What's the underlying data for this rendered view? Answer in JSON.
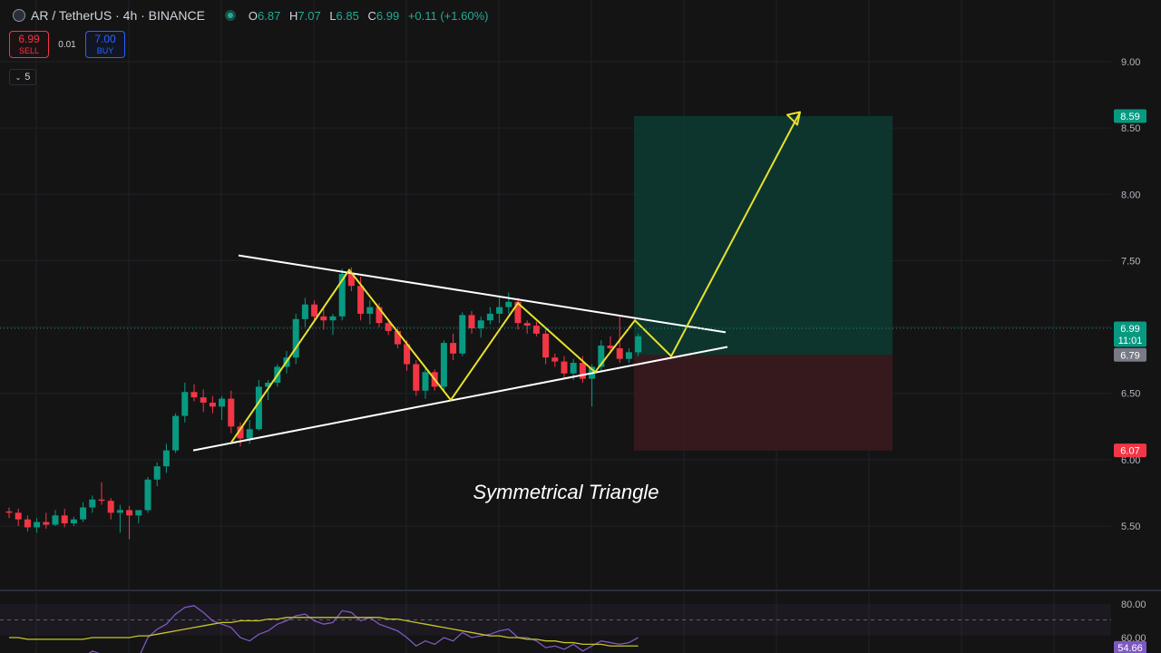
{
  "header": {
    "symbol": "AR / TetherUS · 4h · BINANCE",
    "ohlc": {
      "o_label": "O",
      "o": "6.87",
      "h_label": "H",
      "h": "7.07",
      "l_label": "L",
      "l": "6.85",
      "c_label": "C",
      "c": "6.99",
      "change": "+0.11 (+1.60%)"
    }
  },
  "trade": {
    "sell_price": "6.99",
    "sell_label": "SELL",
    "spread": "0.01",
    "buy_price": "7.00",
    "buy_label": "BUY"
  },
  "indicators_collapse": {
    "count": "5"
  },
  "colors": {
    "up": "#089981",
    "down": "#f23645",
    "pattern_lines": "#ffffff",
    "zigzag": "#e8e12d",
    "rsi": "#7e57c2",
    "rsi_ma": "#c5c52a",
    "target_zone": "#0d3b31",
    "stop_zone": "#3c1a1e"
  },
  "chart_data": {
    "type": "candlestick",
    "title": "Symmetrical Triangle",
    "price_axis": {
      "ticks": [
        "9.00",
        "8.50",
        "8.00",
        "7.50",
        "6.50",
        "6.00",
        "5.50"
      ],
      "range": [
        5.2,
        9.3
      ]
    },
    "labels": {
      "target": {
        "value": "8.59",
        "color": "#089981"
      },
      "last": {
        "value": "6.99",
        "time": "11:01",
        "color": "#089981"
      },
      "entry": {
        "value": "6.79",
        "color": "#787b86"
      },
      "stop": {
        "value": "6.07",
        "color": "#f23645"
      }
    },
    "candles": [
      [
        5.61,
        5.64,
        5.56,
        5.6
      ],
      [
        5.6,
        5.63,
        5.5,
        5.55
      ],
      [
        5.55,
        5.58,
        5.46,
        5.49
      ],
      [
        5.49,
        5.56,
        5.45,
        5.53
      ],
      [
        5.53,
        5.6,
        5.48,
        5.51
      ],
      [
        5.51,
        5.62,
        5.5,
        5.58
      ],
      [
        5.58,
        5.63,
        5.49,
        5.52
      ],
      [
        5.52,
        5.57,
        5.5,
        5.55
      ],
      [
        5.55,
        5.68,
        5.53,
        5.64
      ],
      [
        5.64,
        5.73,
        5.6,
        5.7
      ],
      [
        5.7,
        5.83,
        5.66,
        5.69
      ],
      [
        5.69,
        5.71,
        5.55,
        5.6
      ],
      [
        5.6,
        5.66,
        5.45,
        5.62
      ],
      [
        5.62,
        5.65,
        5.4,
        5.58
      ],
      [
        5.58,
        5.62,
        5.52,
        5.62
      ],
      [
        5.62,
        5.87,
        5.6,
        5.85
      ],
      [
        5.85,
        5.98,
        5.8,
        5.95
      ],
      [
        5.95,
        6.12,
        5.9,
        6.07
      ],
      [
        6.07,
        6.35,
        6.05,
        6.33
      ],
      [
        6.33,
        6.58,
        6.28,
        6.51
      ],
      [
        6.51,
        6.57,
        6.44,
        6.47
      ],
      [
        6.47,
        6.53,
        6.36,
        6.43
      ],
      [
        6.43,
        6.48,
        6.35,
        6.4
      ],
      [
        6.4,
        6.48,
        6.3,
        6.46
      ],
      [
        6.46,
        6.52,
        6.2,
        6.25
      ],
      [
        6.25,
        6.28,
        6.1,
        6.16
      ],
      [
        6.16,
        6.3,
        6.12,
        6.23
      ],
      [
        6.23,
        6.6,
        6.22,
        6.55
      ],
      [
        6.55,
        6.6,
        6.45,
        6.58
      ],
      [
        6.58,
        6.72,
        6.55,
        6.7
      ],
      [
        6.7,
        6.82,
        6.65,
        6.77
      ],
      [
        6.77,
        7.1,
        6.72,
        7.06
      ],
      [
        7.06,
        7.22,
        7.0,
        7.17
      ],
      [
        7.17,
        7.2,
        7.04,
        7.08
      ],
      [
        7.08,
        7.15,
        6.98,
        7.05
      ],
      [
        7.05,
        7.1,
        6.94,
        7.08
      ],
      [
        7.08,
        7.44,
        7.05,
        7.4
      ],
      [
        7.4,
        7.45,
        7.27,
        7.31
      ],
      [
        7.31,
        7.38,
        7.05,
        7.1
      ],
      [
        7.1,
        7.2,
        7.02,
        7.15
      ],
      [
        7.15,
        7.18,
        7.0,
        7.03
      ],
      [
        7.03,
        7.06,
        6.94,
        6.97
      ],
      [
        6.97,
        7.0,
        6.84,
        6.87
      ],
      [
        6.87,
        6.9,
        6.67,
        6.72
      ],
      [
        6.72,
        6.75,
        6.48,
        6.52
      ],
      [
        6.52,
        6.7,
        6.46,
        6.66
      ],
      [
        6.66,
        6.68,
        6.52,
        6.55
      ],
      [
        6.55,
        6.9,
        6.52,
        6.88
      ],
      [
        6.88,
        6.95,
        6.75,
        6.8
      ],
      [
        6.8,
        7.11,
        6.78,
        7.09
      ],
      [
        7.09,
        7.12,
        6.95,
        6.99
      ],
      [
        6.99,
        7.08,
        6.92,
        7.05
      ],
      [
        7.05,
        7.15,
        7.02,
        7.1
      ],
      [
        7.1,
        7.24,
        7.03,
        7.15
      ],
      [
        7.15,
        7.26,
        7.1,
        7.19
      ],
      [
        7.19,
        7.22,
        6.98,
        7.03
      ],
      [
        7.03,
        7.05,
        6.95,
        7.01
      ],
      [
        7.01,
        7.04,
        6.93,
        6.95
      ],
      [
        6.95,
        6.98,
        6.72,
        6.77
      ],
      [
        6.77,
        6.8,
        6.7,
        6.74
      ],
      [
        6.74,
        6.78,
        6.62,
        6.65
      ],
      [
        6.65,
        6.76,
        6.6,
        6.73
      ],
      [
        6.73,
        6.78,
        6.58,
        6.61
      ],
      [
        6.61,
        6.72,
        6.4,
        6.7
      ],
      [
        6.7,
        6.9,
        6.66,
        6.86
      ],
      [
        6.86,
        6.93,
        6.8,
        6.84
      ],
      [
        6.84,
        7.08,
        6.73,
        6.76
      ],
      [
        6.76,
        6.84,
        6.73,
        6.81
      ],
      [
        6.81,
        6.95,
        6.78,
        6.93
      ]
    ],
    "rsi_axis": {
      "ticks": [
        "80.00",
        "60.00"
      ],
      "range": [
        50,
        85
      ]
    },
    "rsi_last": "54.66",
    "rsi": [
      46,
      44,
      42,
      44,
      43,
      46,
      44,
      45,
      48,
      52,
      50,
      46,
      47,
      45,
      48,
      60,
      65,
      68,
      74,
      78,
      79,
      75,
      70,
      68,
      66,
      60,
      58,
      62,
      64,
      68,
      70,
      73,
      74,
      70,
      68,
      69,
      76,
      75,
      70,
      72,
      68,
      66,
      64,
      60,
      55,
      58,
      56,
      60,
      58,
      63,
      60,
      61,
      62,
      64,
      65,
      60,
      60,
      58,
      54,
      55,
      53,
      56,
      52,
      55,
      58,
      57,
      56,
      57,
      60
    ],
    "rsi_ma": [
      60,
      60,
      59,
      59,
      59,
      59,
      59,
      59,
      59,
      60,
      60,
      60,
      60,
      60,
      61,
      61,
      62,
      63,
      64,
      65,
      66,
      67,
      68,
      69,
      69,
      70,
      70,
      70,
      71,
      71,
      72,
      72,
      72,
      72,
      72,
      72,
      72,
      72,
      72,
      72,
      72,
      71,
      71,
      70,
      69,
      68,
      67,
      66,
      65,
      64,
      63,
      62,
      61,
      61,
      60,
      60,
      59,
      59,
      58,
      58,
      57,
      57,
      56,
      56,
      56,
      55,
      55,
      55,
      55
    ]
  }
}
